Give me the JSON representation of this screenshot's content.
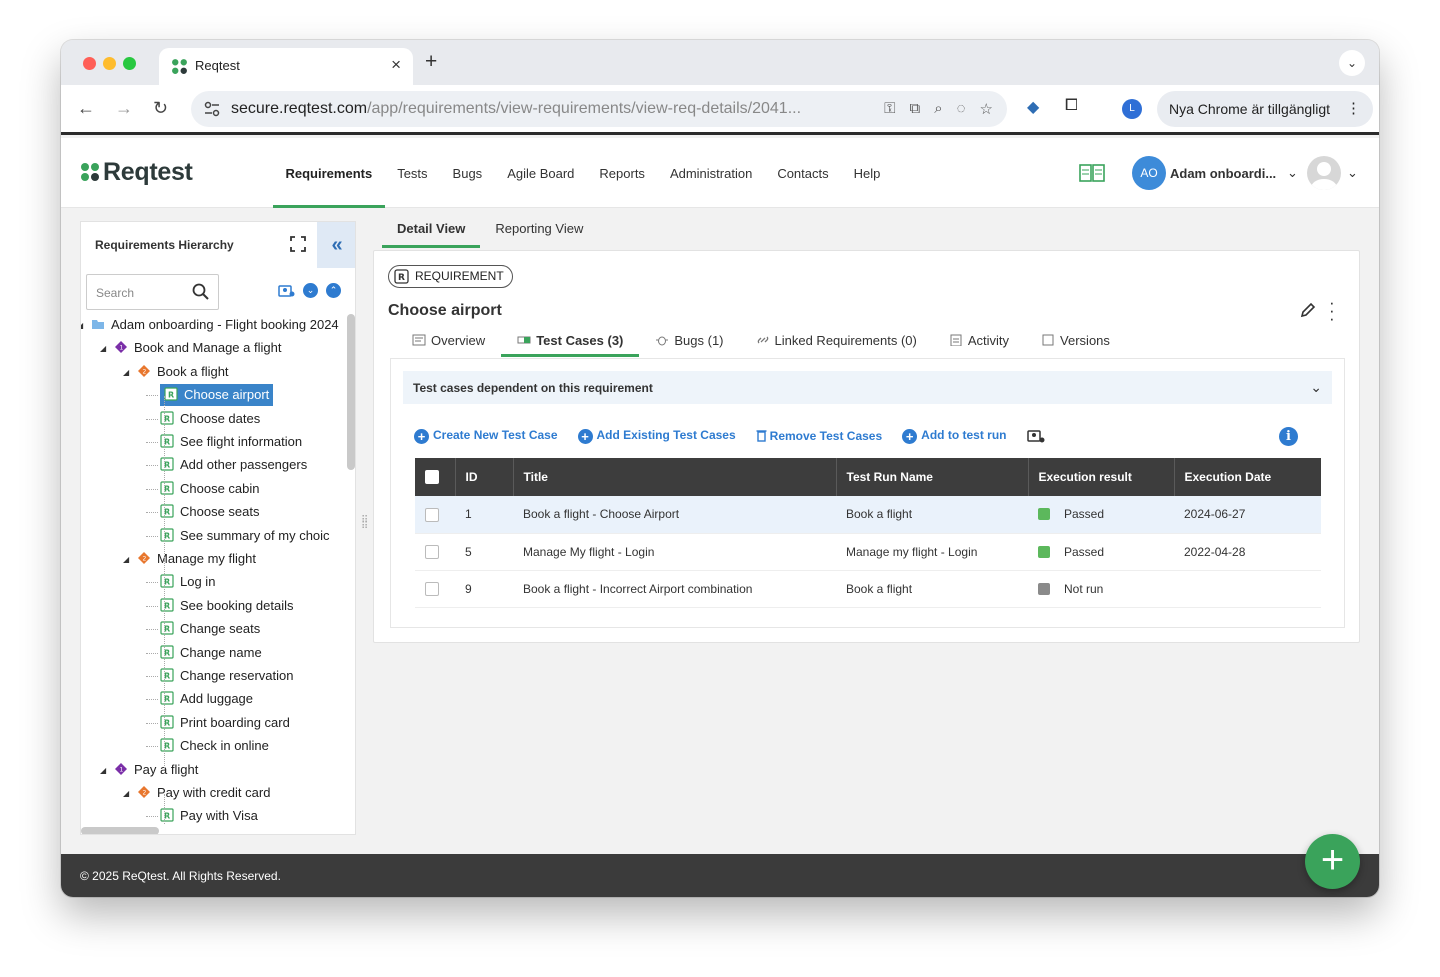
{
  "browser": {
    "tab_title": "Reqtest",
    "url_host": "secure.reqtest.com",
    "url_path": "/app/requirements/view-requirements/view-req-details/2041...",
    "profile_initial": "L",
    "update_label": "Nya Chrome är tillgängligt"
  },
  "app": {
    "logo": "Reqtest",
    "menu": [
      "Requirements",
      "Tests",
      "Bugs",
      "Agile Board",
      "Reports",
      "Administration",
      "Contacts",
      "Help"
    ],
    "user_initials": "AO",
    "user_name": "Adam onboardi..."
  },
  "left": {
    "title": "Requirements Hierarchy",
    "search_placeholder": "Search",
    "tree": [
      {
        "label": "Adam onboarding - Flight booking 2024",
        "level": 0,
        "type": "folder"
      },
      {
        "label": "Book and Manage a flight",
        "level": 1,
        "type": "epic"
      },
      {
        "label": "Book a flight",
        "level": 2,
        "type": "feature"
      },
      {
        "label": "Choose airport",
        "level": 3,
        "type": "req",
        "selected": true
      },
      {
        "label": "Choose dates",
        "level": 3,
        "type": "req"
      },
      {
        "label": "See flight information",
        "level": 3,
        "type": "req"
      },
      {
        "label": "Add other passengers",
        "level": 3,
        "type": "req"
      },
      {
        "label": "Choose cabin",
        "level": 3,
        "type": "req"
      },
      {
        "label": "Choose seats",
        "level": 3,
        "type": "req"
      },
      {
        "label": "See summary of my choic",
        "level": 3,
        "type": "req"
      },
      {
        "label": "Manage my flight",
        "level": 2,
        "type": "feature"
      },
      {
        "label": "Log in",
        "level": 3,
        "type": "req"
      },
      {
        "label": "See booking details",
        "level": 3,
        "type": "req"
      },
      {
        "label": "Change seats",
        "level": 3,
        "type": "req"
      },
      {
        "label": "Change name",
        "level": 3,
        "type": "req"
      },
      {
        "label": "Change reservation",
        "level": 3,
        "type": "req"
      },
      {
        "label": "Add luggage",
        "level": 3,
        "type": "req"
      },
      {
        "label": "Print boarding card",
        "level": 3,
        "type": "req"
      },
      {
        "label": "Check in online",
        "level": 3,
        "type": "req"
      },
      {
        "label": "Pay a flight",
        "level": 1,
        "type": "epic"
      },
      {
        "label": "Pay with credit card",
        "level": 2,
        "type": "feature"
      },
      {
        "label": "Pay with Visa",
        "level": 3,
        "type": "req"
      }
    ]
  },
  "view_tabs": [
    "Detail View",
    "Reporting View"
  ],
  "detail": {
    "badge": "REQUIREMENT",
    "title": "Choose airport",
    "tabs": [
      "Overview",
      "Test Cases (3)",
      "Bugs (1)",
      "Linked Requirements (0)",
      "Activity",
      "Versions"
    ],
    "section_title": "Test cases dependent on this requirement",
    "actions": [
      "Create New Test Case",
      "Add Existing Test Cases",
      "Remove Test Cases",
      "Add to test run"
    ],
    "columns": [
      "ID",
      "Title",
      "Test Run Name",
      "Execution result",
      "Execution Date"
    ],
    "rows": [
      {
        "id": "1",
        "title": "Book a flight - Choose Airport",
        "run": "Book a flight",
        "result": "Passed",
        "color": "#5cb85c",
        "date": "2024-06-27"
      },
      {
        "id": "5",
        "title": "Manage My flight - Login",
        "run": "Manage my flight - Login",
        "result": "Passed",
        "color": "#5cb85c",
        "date": "2022-04-28"
      },
      {
        "id": "9",
        "title": "Book a flight - Incorrect Airport combination",
        "run": "Book a flight",
        "result": "Not run",
        "color": "#8a8a8a",
        "date": ""
      }
    ]
  },
  "footer": "© 2025 ReQtest. All Rights Reserved.",
  "colors": {
    "accent": "#3aa35b",
    "link": "#2e7bd0",
    "header_dark": "#3d3d3d"
  }
}
